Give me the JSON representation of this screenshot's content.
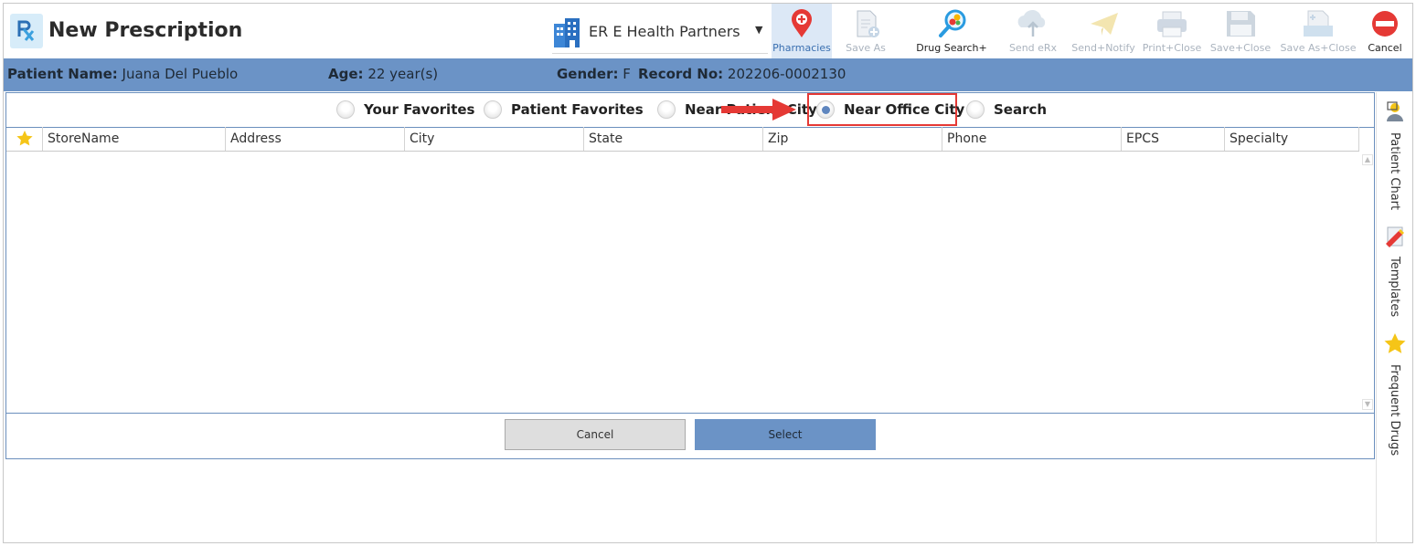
{
  "header": {
    "title": "New Prescription",
    "organization": "ER E Health Partners"
  },
  "toolbar": [
    {
      "label": "Pharmacies",
      "icon": "map-pin-plus-icon",
      "state": "active"
    },
    {
      "label": "Save As",
      "icon": "document-plus-icon",
      "state": "disabled"
    },
    {
      "label": "Drug Search+",
      "icon": "magnify-pills-icon",
      "state": "enabled"
    },
    {
      "label": "Send eRx",
      "icon": "cloud-upload-icon",
      "state": "disabled"
    },
    {
      "label": "Send+Notify",
      "icon": "paper-plane-icon",
      "state": "disabled"
    },
    {
      "label": "Print+Close",
      "icon": "printer-icon",
      "state": "disabled"
    },
    {
      "label": "Save+Close",
      "icon": "floppy-disk-icon",
      "state": "disabled"
    },
    {
      "label": "Save As+Close",
      "icon": "document-save-icon",
      "state": "disabled"
    },
    {
      "label": "Cancel",
      "icon": "no-entry-icon",
      "state": "enabled"
    }
  ],
  "patient": {
    "name_label": "Patient Name:",
    "name": "Juana Del Pueblo",
    "age_label": "Age:",
    "age": "22 year(s)",
    "gender_label": "Gender:",
    "gender": "F",
    "record_label": "Record No:",
    "record": "202206-0002130"
  },
  "filters": [
    {
      "label": "Your Favorites",
      "selected": false
    },
    {
      "label": "Patient Favorites",
      "selected": false
    },
    {
      "label": "Near Patient City",
      "selected": false
    },
    {
      "label": "Near Office City",
      "selected": true
    },
    {
      "label": "Search",
      "selected": false
    }
  ],
  "grid": {
    "columns": [
      "StoreName",
      "Address",
      "City",
      "State",
      "Zip",
      "Phone",
      "EPCS",
      "Specialty"
    ],
    "rows": []
  },
  "buttons": {
    "cancel": "Cancel",
    "select": "Select"
  },
  "side_panel": [
    {
      "label": "Patient Chart",
      "icon": "patient-chart-icon"
    },
    {
      "label": "Templates",
      "icon": "templates-icon"
    },
    {
      "label": "Frequent Drugs",
      "icon": "star-icon"
    }
  ],
  "colors": {
    "accent": "#6b93c6",
    "highlight": "#e53935",
    "star": "#f5c518"
  }
}
